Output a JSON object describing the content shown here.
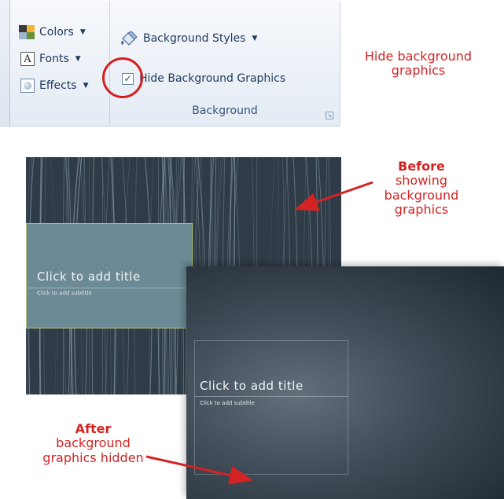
{
  "ribbon": {
    "themes": {
      "colors_label": "Colors",
      "fonts_label": "Fonts",
      "fonts_glyph": "A",
      "effects_label": "Effects"
    },
    "background": {
      "styles_label": "Background Styles",
      "hide_label": "Hide Background Graphics",
      "hide_checked": true,
      "group_label": "Background"
    }
  },
  "annotations": {
    "top": "Hide background graphics",
    "before_bold": "Before",
    "before_rest": [
      "showing",
      "background",
      "graphics"
    ],
    "after_bold": "After",
    "after_rest": [
      "background",
      "graphics hidden"
    ]
  },
  "slides": {
    "before": {
      "title": "Click to add title",
      "subtitle": "Click to add subtitle"
    },
    "after": {
      "title": "Click to add title",
      "subtitle": "Click to add subtitle"
    }
  },
  "colors": {
    "annotation_red": "#d42323",
    "ring_red": "#d51d20",
    "ribbon_text": "#1e395b",
    "slide_dark": "#2f3b46",
    "title_box": "#6b8a95"
  },
  "icons": [
    "colors-icon",
    "fonts-icon",
    "effects-icon",
    "background-styles-icon",
    "checkbox-checked-icon",
    "dialog-launcher-icon"
  ]
}
